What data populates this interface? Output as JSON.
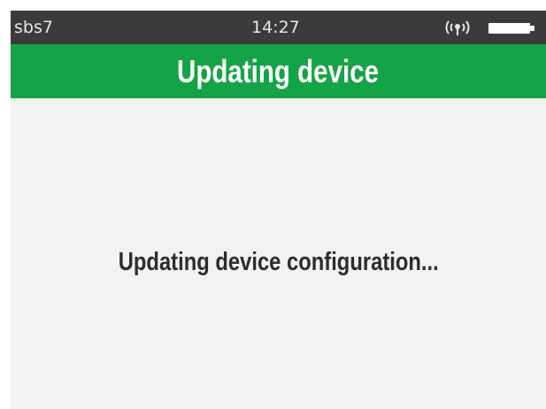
{
  "status_bar": {
    "device_name": "sbs7",
    "time": "14:27",
    "signal_icon": "wireless-signal-icon",
    "battery_icon": "battery-full-icon"
  },
  "header": {
    "title": "Updating device"
  },
  "main": {
    "message": "Updating device configuration..."
  },
  "colors": {
    "status_bar_bg": "#3b3b3b",
    "header_bg": "#14a346",
    "content_bg": "#f1f3f1",
    "message_text": "#2d2d2d"
  }
}
